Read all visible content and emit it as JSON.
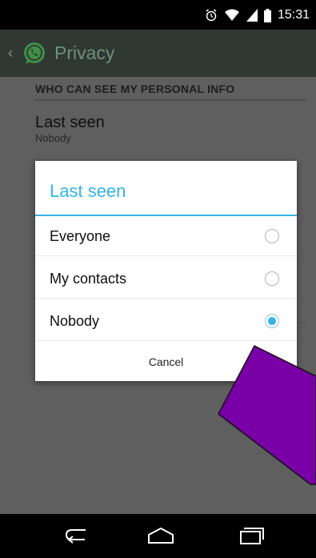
{
  "status_bar": {
    "time": "15:31",
    "icons": [
      "alarm-icon",
      "wifi-icon",
      "signal-icon",
      "battery-icon"
    ]
  },
  "action_bar": {
    "title": "Privacy",
    "icons": [
      "up-chevron-icon",
      "whatsapp-logo-icon"
    ]
  },
  "settings": {
    "section_header": "WHO CAN SEE MY PERSONAL INFO",
    "last_seen": {
      "title": "Last seen",
      "summary": "Nobody"
    }
  },
  "dialog": {
    "title": "Last seen",
    "options": [
      {
        "label": "Everyone",
        "selected": false
      },
      {
        "label": "My contacts",
        "selected": false
      },
      {
        "label": "Nobody",
        "selected": true
      }
    ],
    "cancel_label": "Cancel"
  },
  "navigation_bar": {
    "icons": [
      "back-icon",
      "home-icon",
      "recents-icon"
    ]
  },
  "colors": {
    "accent": "#33b5e5",
    "action_bar": "#2f3832",
    "annotation": "#7800a6"
  }
}
